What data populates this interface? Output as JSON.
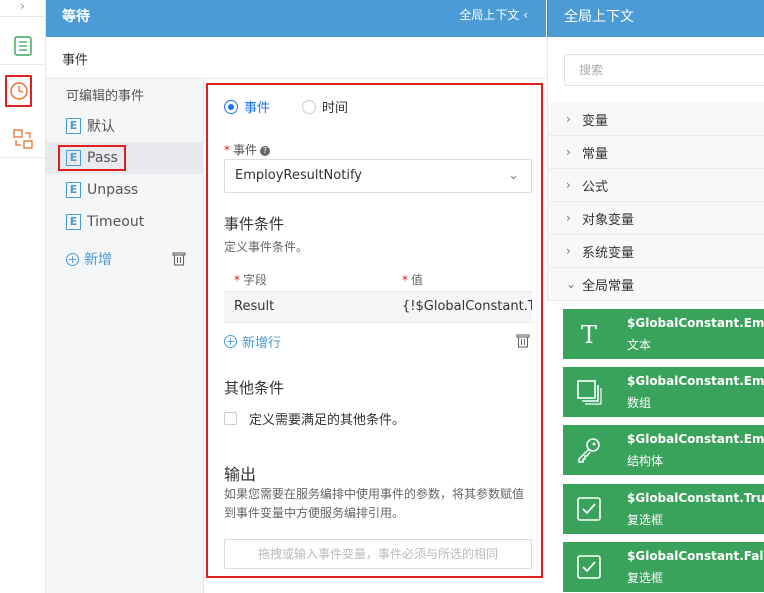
{
  "left_bar": {
    "collapse_icon": "chevron-right-icon",
    "items": [
      {
        "icon": "list-icon"
      },
      {
        "icon": "clock-icon"
      },
      {
        "icon": "swap-icon"
      }
    ]
  },
  "header": {
    "title": "等待",
    "context_label": "全局上下文",
    "context_icon": "chevron-left-icon"
  },
  "subheader": {
    "title": "事件"
  },
  "event_list": {
    "heading": "可编辑的事件",
    "badge_letter": "E",
    "items": [
      {
        "label": "默认"
      },
      {
        "label": "Pass"
      },
      {
        "label": "Unpass"
      },
      {
        "label": "Timeout"
      }
    ],
    "add_label": "新增"
  },
  "event_panel": {
    "radio_event": "事件",
    "radio_time": "时间",
    "event_field_label": "事件",
    "event_value": "EmployResultNotify",
    "conditions_title": "事件条件",
    "conditions_desc": "定义事件条件。",
    "table": {
      "col_field": "字段",
      "col_value": "值",
      "rows": [
        {
          "field": "Result",
          "value": "{!$GlobalConstant.True}"
        }
      ]
    },
    "add_row_label": "新增行",
    "other_title": "其他条件",
    "other_checkbox_label": "定义需要满足的其他条件。",
    "output_title": "输出",
    "output_desc": "如果您需要在服务编排中使用事件的参数，将其参数赋值到事件变量中方便服务编排引用。",
    "output_placeholder": "拖拽或输入事件变量，事件必须与所选的相同"
  },
  "right_panel": {
    "title": "全局上下文",
    "search_placeholder": "搜索",
    "groups": [
      {
        "label": "变量",
        "expanded": false
      },
      {
        "label": "常量",
        "expanded": false
      },
      {
        "label": "公式",
        "expanded": false
      },
      {
        "label": "对象变量",
        "expanded": false
      },
      {
        "label": "系统变量",
        "expanded": false
      },
      {
        "label": "全局常量",
        "expanded": true
      }
    ],
    "constants": [
      {
        "name": "$GlobalConstant.Emp...",
        "kind": "文本",
        "icon": "text-icon"
      },
      {
        "name": "$GlobalConstant.Emp...",
        "kind": "数组",
        "icon": "array-icon"
      },
      {
        "name": "$GlobalConstant.Emp...",
        "kind": "结构体",
        "icon": "key-icon"
      },
      {
        "name": "$GlobalConstant.True",
        "kind": "复选框",
        "icon": "checkbox-icon"
      },
      {
        "name": "$GlobalConstant.False",
        "kind": "复选框",
        "icon": "checkbox-icon"
      }
    ]
  },
  "colors": {
    "header_blue": "#4a9bd6",
    "highlight_red": "#e02020",
    "card_green": "#3aa35b",
    "link_blue": "#4a9bd6"
  }
}
